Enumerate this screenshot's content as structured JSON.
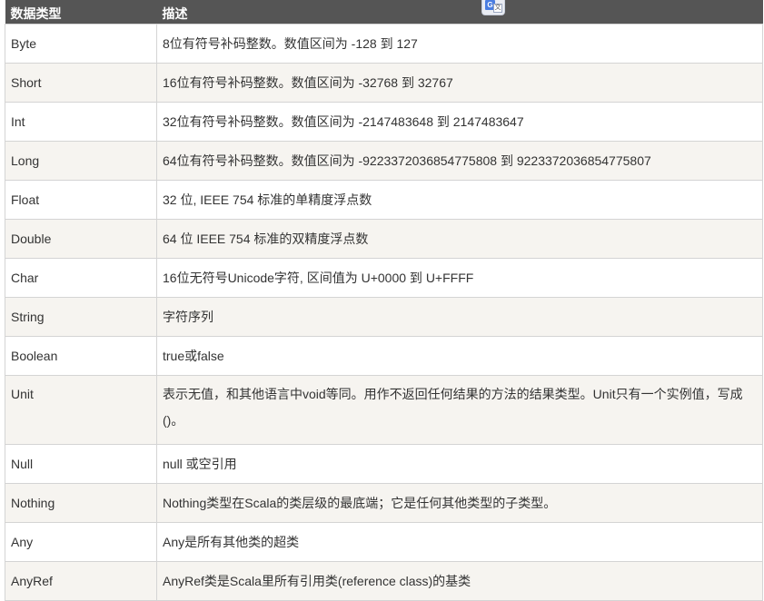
{
  "table": {
    "headers": [
      "数据类型",
      "描述"
    ],
    "rows": [
      {
        "type": "Byte",
        "desc": "8位有符号补码整数。数值区间为 -128 到 127"
      },
      {
        "type": "Short",
        "desc": "16位有符号补码整数。数值区间为 -32768 到 32767"
      },
      {
        "type": "Int",
        "desc": "32位有符号补码整数。数值区间为 -2147483648 到 2147483647"
      },
      {
        "type": "Long",
        "desc": "64位有符号补码整数。数值区间为 -9223372036854775808 到 9223372036854775807"
      },
      {
        "type": "Float",
        "desc": "32 位, IEEE 754 标准的单精度浮点数"
      },
      {
        "type": "Double",
        "desc": "64 位 IEEE 754 标准的双精度浮点数"
      },
      {
        "type": "Char",
        "desc": "16位无符号Unicode字符, 区间值为 U+0000 到 U+FFFF"
      },
      {
        "type": "String",
        "desc": "字符序列"
      },
      {
        "type": "Boolean",
        "desc": "true或false"
      },
      {
        "type": "Unit",
        "desc": "表示无值，和其他语言中void等同。用作不返回任何结果的方法的结果类型。Unit只有一个实例值，写成()。"
      },
      {
        "type": "Null",
        "desc": "null 或空引用"
      },
      {
        "type": "Nothing",
        "desc": "Nothing类型在Scala的类层级的最底端；它是任何其他类型的子类型。"
      },
      {
        "type": "Any",
        "desc": "Any是所有其他类的超类"
      },
      {
        "type": "AnyRef",
        "desc": "AnyRef类是Scala里所有引用类(reference class)的基类"
      }
    ]
  },
  "translate_icon": {
    "icon": "google-translate-icon",
    "glyph_g": "G",
    "glyph_w": "文"
  }
}
